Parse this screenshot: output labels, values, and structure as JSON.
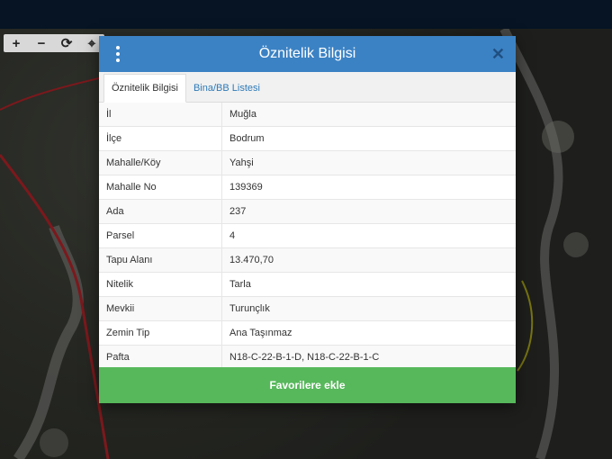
{
  "map_tools": {
    "zoom_in": "+",
    "zoom_out": "−",
    "refresh": "⟳",
    "locate": "⌖"
  },
  "modal": {
    "title": "Öznitelik Bilgisi",
    "close_label": "✕",
    "tabs": [
      {
        "label": "Öznitelik Bilgisi",
        "active": true
      },
      {
        "label": "Bina/BB Listesi",
        "active": false
      }
    ],
    "rows": [
      {
        "key": "İl",
        "value": "Muğla"
      },
      {
        "key": "İlçe",
        "value": "Bodrum"
      },
      {
        "key": "Mahalle/Köy",
        "value": "Yahşi"
      },
      {
        "key": "Mahalle No",
        "value": "139369"
      },
      {
        "key": "Ada",
        "value": "237"
      },
      {
        "key": "Parsel",
        "value": "4"
      },
      {
        "key": "Tapu Alanı",
        "value": "13.470,70"
      },
      {
        "key": "Nitelik",
        "value": "Tarla"
      },
      {
        "key": "Mevkii",
        "value": "Turunçlık"
      },
      {
        "key": "Zemin Tip",
        "value": "Ana Taşınmaz"
      },
      {
        "key": "Pafta",
        "value": "N18-C-22-B-1-D, N18-C-22-B-1-C"
      }
    ],
    "favorite_button": "Favorilere ekle"
  },
  "colors": {
    "header": "#3b82c4",
    "button": "#57b85b",
    "parcel_border": "#d8262b"
  }
}
